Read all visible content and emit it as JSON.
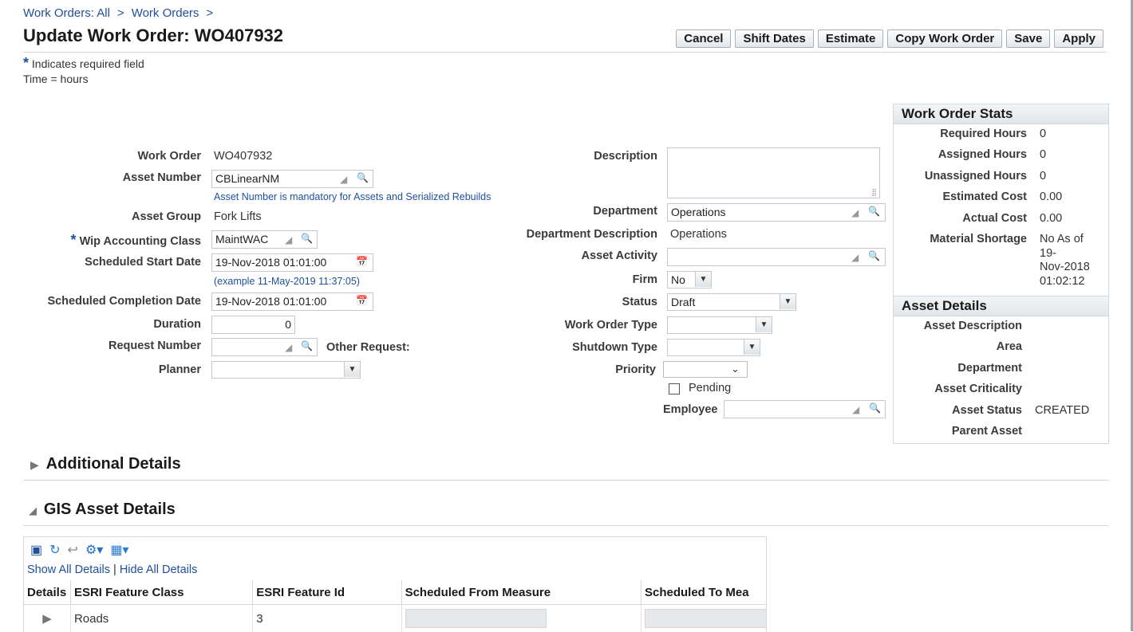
{
  "breadcrumb": {
    "item1": "Work Orders: All",
    "item2": "Work Orders",
    "sep": ">"
  },
  "page_title": "Update Work Order: WO407932",
  "buttons": {
    "cancel": "Cancel",
    "shift_dates": "Shift Dates",
    "estimate": "Estimate",
    "copy": "Copy Work Order",
    "save": "Save",
    "apply": "Apply"
  },
  "notes": {
    "required": "Indicates required field",
    "time": "Time = hours",
    "star": "*"
  },
  "left_form": {
    "work_order_label": "Work Order",
    "work_order_value": "WO407932",
    "asset_number_label": "Asset Number",
    "asset_number_value": "CBLinearNM",
    "asset_number_hint": "Asset Number is mandatory for Assets and Serialized Rebuilds",
    "asset_group_label": "Asset Group",
    "asset_group_value": "Fork Lifts",
    "wip_label": "Wip Accounting Class",
    "wip_value": "MaintWAC",
    "start_label": "Scheduled Start Date",
    "start_value": "19-Nov-2018 01:01:00",
    "date_example": "(example 11-May-2019 11:37:05)",
    "completion_label": "Scheduled Completion Date",
    "completion_value": "19-Nov-2018 01:01:00",
    "duration_label": "Duration",
    "duration_value": "0",
    "request_label": "Request Number",
    "request_value": "",
    "other_request_label": "Other Request:",
    "planner_label": "Planner",
    "planner_value": ""
  },
  "mid_form": {
    "description_label": "Description",
    "description_value": "",
    "department_label": "Department",
    "department_value": "Operations",
    "dept_desc_label": "Department Description",
    "dept_desc_value": "Operations",
    "asset_activity_label": "Asset Activity",
    "asset_activity_value": "",
    "firm_label": "Firm",
    "firm_value": "No",
    "status_label": "Status",
    "status_value": "Draft",
    "wo_type_label": "Work Order Type",
    "wo_type_value": "",
    "shutdown_label": "Shutdown Type",
    "shutdown_value": "",
    "priority_label": "Priority",
    "priority_value": "",
    "pending_label": "Pending",
    "employee_label": "Employee",
    "employee_value": ""
  },
  "stats": {
    "title": "Work Order Stats",
    "rows": [
      {
        "label": "Required Hours",
        "value": "0"
      },
      {
        "label": "Assigned Hours",
        "value": "0"
      },
      {
        "label": "Unassigned Hours",
        "value": "0"
      },
      {
        "label": "Estimated Cost",
        "value": "0.00"
      },
      {
        "label": "Actual Cost",
        "value": "0.00"
      }
    ],
    "shortage_label": "Material Shortage",
    "shortage_lines": [
      "No As of",
      "19-",
      "Nov-2018",
      "01:02:12"
    ]
  },
  "asset_details": {
    "title": "Asset Details",
    "rows": [
      {
        "label": "Asset Description",
        "value": ""
      },
      {
        "label": "Area",
        "value": ""
      },
      {
        "label": "Department",
        "value": ""
      },
      {
        "label": "Asset Criticality",
        "value": ""
      },
      {
        "label": "Asset Status",
        "value": "CREATED"
      },
      {
        "label": "Parent Asset",
        "value": ""
      }
    ]
  },
  "sections": {
    "additional": "Additional Details",
    "gis": "GIS Asset Details"
  },
  "gis": {
    "show_all": "Show All Details",
    "divider": "|",
    "hide_all": "Hide All Details",
    "columns": [
      "Details",
      "ESRI Feature Class",
      "ESRI Feature Id",
      "Scheduled From Measure",
      "Scheduled To Mea"
    ],
    "rows": [
      {
        "feature_class": "Roads",
        "feature_id": "3"
      }
    ]
  }
}
